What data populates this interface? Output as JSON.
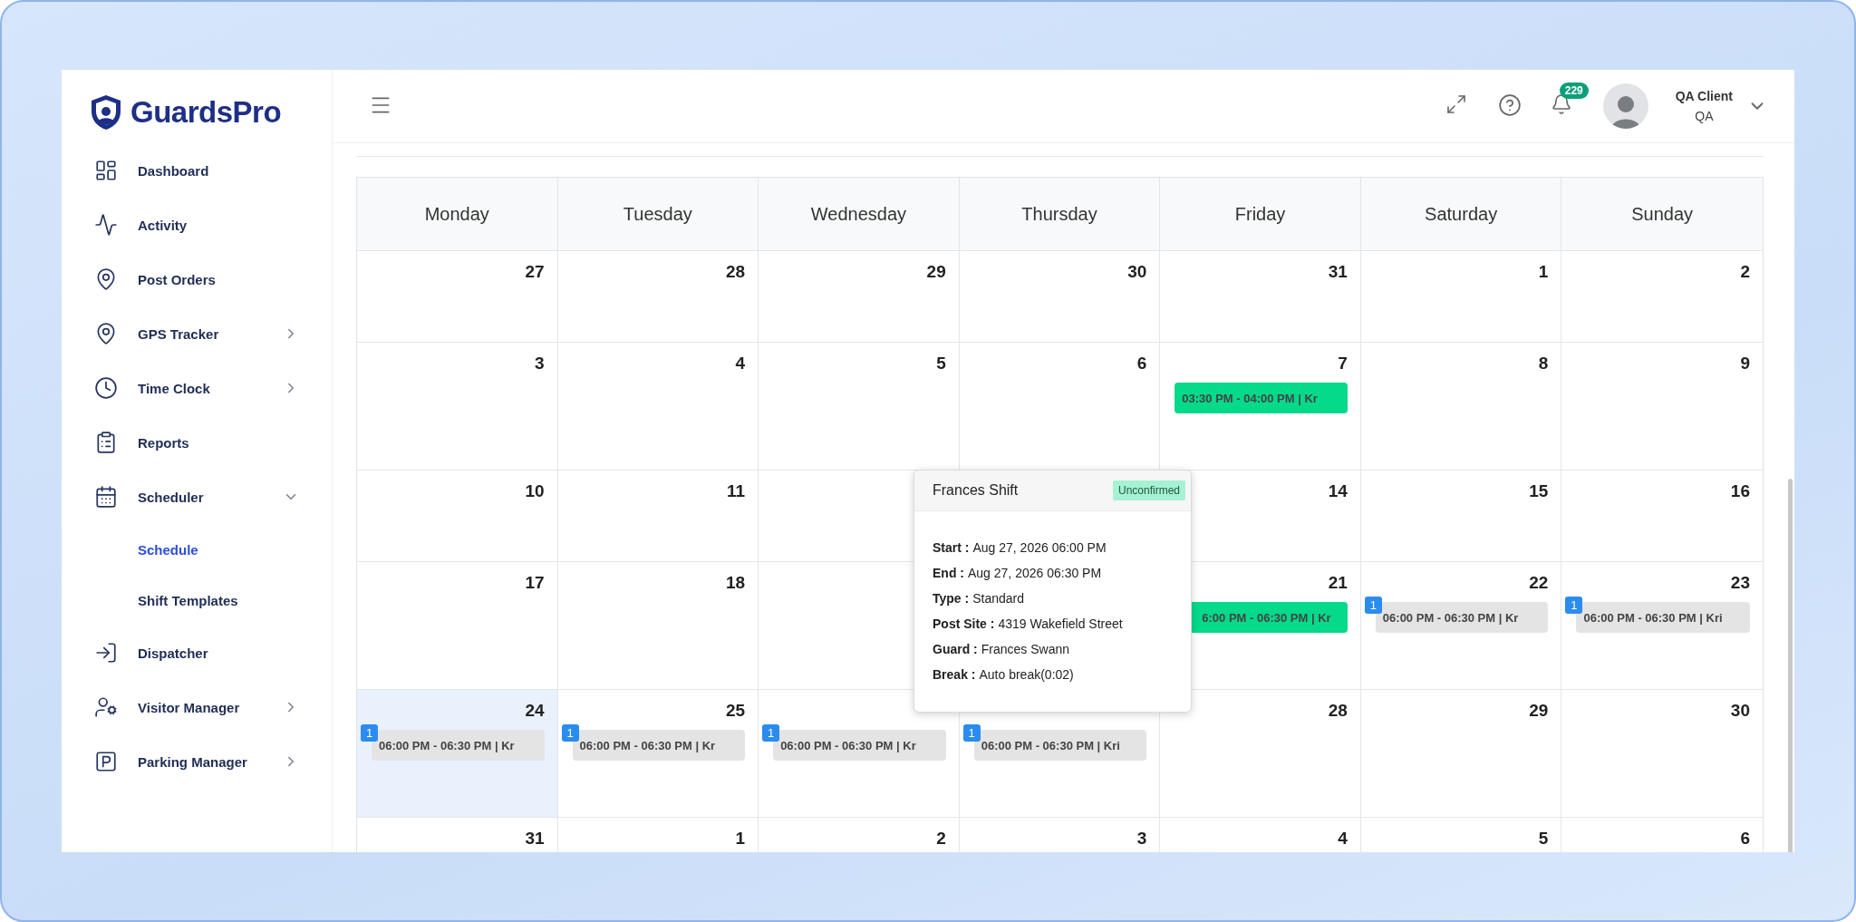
{
  "brand": "GuardsPro",
  "sidebar": {
    "items": [
      {
        "label": "Dashboard",
        "submenu": false,
        "selected": false
      },
      {
        "label": "Activity",
        "submenu": false,
        "selected": false
      },
      {
        "label": "Post Orders",
        "submenu": false,
        "selected": false
      },
      {
        "label": "GPS Tracker",
        "submenu": true,
        "expanded": false,
        "selected": false
      },
      {
        "label": "Time Clock",
        "submenu": true,
        "expanded": false,
        "selected": false
      },
      {
        "label": "Reports",
        "submenu": false,
        "selected": false
      },
      {
        "label": "Scheduler",
        "submenu": true,
        "expanded": true,
        "selected": false,
        "children": [
          {
            "label": "Schedule",
            "selected": true
          },
          {
            "label": "Shift Templates",
            "selected": false
          }
        ]
      },
      {
        "label": "Dispatcher",
        "submenu": false,
        "selected": false
      },
      {
        "label": "Visitor Manager",
        "submenu": true,
        "expanded": false,
        "selected": false
      },
      {
        "label": "Parking Manager",
        "submenu": true,
        "expanded": false,
        "selected": false
      }
    ]
  },
  "header": {
    "notification_count": "229",
    "user_name": "QA Client",
    "user_role": "QA"
  },
  "calendar": {
    "weekdays": [
      "Monday",
      "Tuesday",
      "Wednesday",
      "Thursday",
      "Friday",
      "Saturday",
      "Sunday"
    ],
    "weeks": [
      {
        "days": [
          {
            "date": "27",
            "today": false
          },
          {
            "date": "28",
            "today": false
          },
          {
            "date": "29",
            "today": false
          },
          {
            "date": "30",
            "today": false
          },
          {
            "date": "31",
            "today": false
          },
          {
            "date": "1",
            "today": false
          },
          {
            "date": "2",
            "today": false
          }
        ]
      },
      {
        "days": [
          {
            "date": "3",
            "today": false
          },
          {
            "date": "4",
            "today": false
          },
          {
            "date": "5",
            "today": false
          },
          {
            "date": "6",
            "today": false
          },
          {
            "date": "7",
            "today": false,
            "events": [
              {
                "text": "03:30 PM - 04:00 PM | Kr",
                "color": "#05d98a"
              }
            ]
          },
          {
            "date": "8",
            "today": false
          },
          {
            "date": "9",
            "today": false
          }
        ]
      },
      {
        "days": [
          {
            "date": "10",
            "today": false
          },
          {
            "date": "11",
            "today": false
          },
          {
            "today": false
          },
          {
            "date": "14",
            "today": false
          },
          {
            "date": "15",
            "today": false
          },
          {
            "date": "16",
            "today": false
          }
        ]
      },
      {
        "days": [
          {
            "date": "17",
            "today": false
          },
          {
            "date": "18",
            "today": false
          },
          {
            "today": false
          },
          {
            "date": "21",
            "today": false,
            "events": [
              {
                "text": "6:00 PM - 06:30 PM | Kr",
                "color": "#05d98a"
              }
            ]
          },
          {
            "date": "22",
            "today": false,
            "events": [
              {
                "text": "06:00 PM - 06:30 PM | Kr",
                "color": "#e4e4e4",
                "badge": "1"
              }
            ]
          },
          {
            "date": "23",
            "today": false,
            "events": [
              {
                "text": "06:00 PM - 06:30 PM | Kri",
                "color": "#e4e4e4",
                "badge": "1"
              }
            ]
          }
        ]
      },
      {
        "days": [
          {
            "date": "24",
            "today": true,
            "events": [
              {
                "text": "06:00 PM - 06:30 PM | Kr",
                "color": "#e4e4e4",
                "badge": "1"
              }
            ]
          },
          {
            "date": "25",
            "today": false,
            "events": [
              {
                "text": "06:00 PM - 06:30 PM | Kr",
                "color": "#e4e4e4",
                "badge": "1"
              }
            ]
          },
          {
            "today": false,
            "events": [
              {
                "text": "06:00 PM - 06:30 PM | Kr",
                "color": "#e4e4e4",
                "badge": "1"
              }
            ]
          },
          {
            "today": false,
            "events": [
              {
                "text": "06:00 PM - 06:30 PM | Kri",
                "color": "#e4e4e4",
                "badge": "1"
              }
            ]
          },
          {
            "date": "28",
            "today": false
          },
          {
            "date": "29",
            "today": false
          },
          {
            "date": "30",
            "today": false
          }
        ]
      },
      {
        "days": [
          {
            "date": "31",
            "today": false
          },
          {
            "date": "1",
            "today": false
          },
          {
            "date": "2",
            "today": false
          },
          {
            "date": "3",
            "today": false
          },
          {
            "date": "4",
            "today": false
          },
          {
            "date": "5",
            "today": false
          },
          {
            "date": "6",
            "today": false
          }
        ]
      }
    ]
  },
  "popover": {
    "title": "Frances Shift",
    "status": "Unconfirmed",
    "fields": [
      {
        "label": "Start :",
        "value": "Aug 27, 2026 06:00 PM"
      },
      {
        "label": "End :",
        "value": "Aug 27, 2026 06:30 PM"
      },
      {
        "label": "Type :",
        "value": "Standard"
      },
      {
        "label": "Post Site :",
        "value": "4319 Wakefield Street"
      },
      {
        "label": "Guard :",
        "value": "Frances Swann"
      },
      {
        "label": "Break :",
        "value": "Auto break(0:02)"
      }
    ]
  }
}
